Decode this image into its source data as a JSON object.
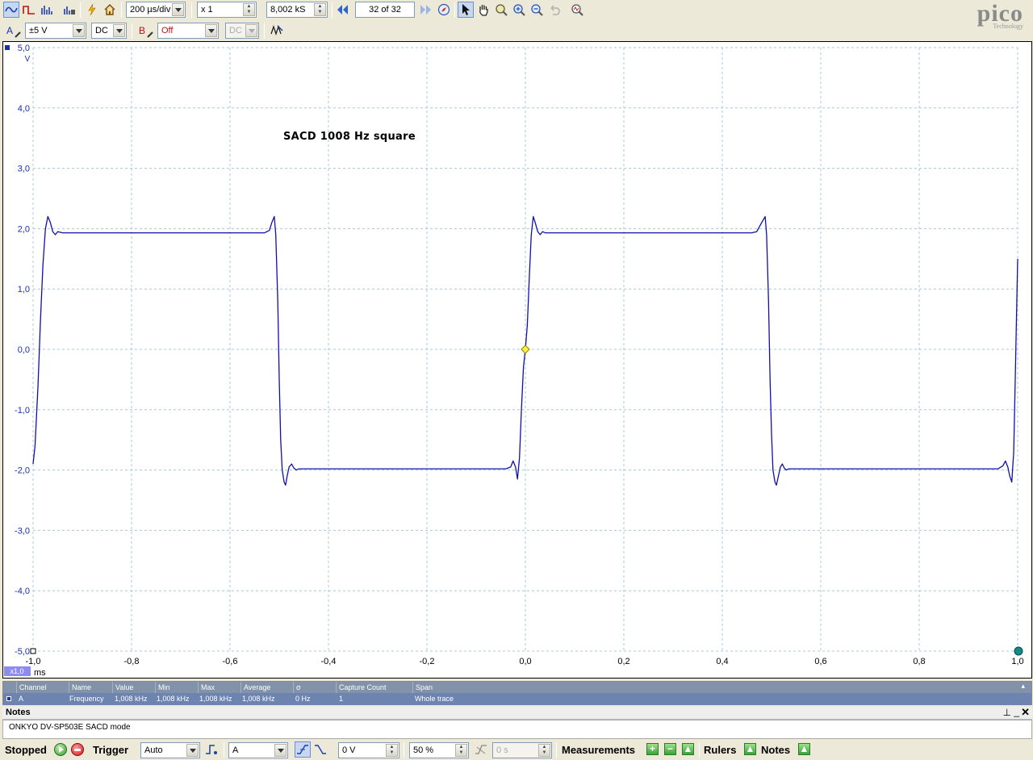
{
  "toolbar": {
    "timebase": "200 µs/div",
    "zoom": "x 1",
    "samples": "8,002 kS",
    "capture_index": "32 of 32"
  },
  "channel_a": {
    "label": "A",
    "range": "±5 V",
    "coupling": "DC"
  },
  "channel_b": {
    "label": "B",
    "range": "Off",
    "coupling": "DC"
  },
  "logo": {
    "main": "pico",
    "sub": "Technology"
  },
  "scope": {
    "title": "SACD 1008 Hz square",
    "y_unit": "V",
    "x_unit": "ms",
    "zoom_badge": "x1,0",
    "trace_color": "#1010a8",
    "grid_color": "#a8c8d8"
  },
  "chart_data": {
    "type": "line",
    "title": "SACD 1008 Hz square",
    "xlabel": "ms",
    "ylabel": "V",
    "xlim": [
      -1.0,
      1.0
    ],
    "ylim": [
      -5.0,
      5.0
    ],
    "grid": true,
    "x_ticks": [
      "-1,0",
      "-0,8",
      "-0,6",
      "-0,4",
      "-0,2",
      "0,0",
      "0,2",
      "0,4",
      "0,6",
      "0,8",
      "1,0"
    ],
    "y_ticks": [
      "5,0",
      "4,0",
      "3,0",
      "2,0",
      "1,0",
      "0,0",
      "-1,0",
      "-2,0",
      "-3,0",
      "-4,0",
      "-5,0"
    ],
    "series": [
      {
        "x": [
          -1.0,
          -0.996,
          -0.99,
          -0.985,
          -0.98,
          -0.975,
          -0.97,
          -0.965,
          -0.96,
          -0.955,
          -0.95,
          -0.94,
          -0.93,
          -0.9,
          -0.7,
          -0.53,
          -0.52,
          -0.515,
          -0.51,
          -0.507,
          -0.503,
          -0.5,
          -0.497,
          -0.494,
          -0.49,
          -0.487,
          -0.484,
          -0.48,
          -0.475,
          -0.47,
          -0.465,
          -0.46,
          -0.45,
          -0.4,
          -0.1,
          -0.04,
          -0.03,
          -0.025,
          -0.02,
          -0.016,
          -0.012,
          -0.008,
          -0.004,
          0.0,
          0.004,
          0.008,
          0.012,
          0.016,
          0.02,
          0.025,
          0.03,
          0.035,
          0.04,
          0.05,
          0.1,
          0.45,
          0.46,
          0.47,
          0.48,
          0.487,
          0.49,
          0.494,
          0.497,
          0.5,
          0.503,
          0.507,
          0.51,
          0.514,
          0.518,
          0.522,
          0.526,
          0.53,
          0.535,
          0.54,
          0.55,
          0.6,
          0.9,
          0.96,
          0.97,
          0.975,
          0.98,
          0.984,
          0.988,
          0.992,
          0.995,
          0.998,
          1.0
        ],
        "y": [
          -1.9,
          -1.6,
          -0.6,
          0.5,
          1.4,
          2.0,
          2.2,
          2.1,
          1.95,
          1.9,
          1.95,
          1.93,
          1.93,
          1.93,
          1.93,
          1.93,
          1.97,
          2.1,
          2.2,
          1.9,
          0.8,
          -0.5,
          -1.5,
          -2.0,
          -2.2,
          -2.25,
          -2.1,
          -1.95,
          -1.9,
          -1.97,
          -2.0,
          -1.98,
          -1.98,
          -1.98,
          -1.98,
          -1.98,
          -1.95,
          -1.85,
          -1.95,
          -2.15,
          -1.8,
          -1.0,
          -0.3,
          0.0,
          0.4,
          1.2,
          1.9,
          2.2,
          2.1,
          1.95,
          1.9,
          1.95,
          1.93,
          1.93,
          1.93,
          1.93,
          1.93,
          1.95,
          2.1,
          2.2,
          1.9,
          0.8,
          -0.5,
          -1.4,
          -2.0,
          -2.2,
          -2.25,
          -2.1,
          -1.95,
          -1.9,
          -1.97,
          -2.0,
          -1.98,
          -1.98,
          -1.98,
          -1.98,
          -1.98,
          -1.98,
          -1.93,
          -1.85,
          -1.95,
          -2.1,
          -2.2,
          -1.7,
          -0.5,
          0.7,
          1.5
        ]
      }
    ]
  },
  "measurements": {
    "headers": [
      "Channel",
      "Name",
      "Value",
      "Min",
      "Max",
      "Average",
      "σ",
      "Capture Count",
      "Span"
    ],
    "row": [
      "A",
      "Frequency",
      "1,008 kHz",
      "1,008 kHz",
      "1,008 kHz",
      "1,008 kHz",
      "0 Hz",
      "1",
      "Whole trace"
    ]
  },
  "notes": {
    "title": "Notes",
    "text": "ONKYO DV-SP503E SACD mode"
  },
  "statusbar": {
    "state": "Stopped",
    "trigger_label": "Trigger",
    "trigger_mode": "Auto",
    "trigger_source": "A",
    "trigger_level": "0 V",
    "pre_trigger": "50 %",
    "delay": "0 s",
    "measurements_label": "Measurements",
    "rulers_label": "Rulers",
    "notes_label": "Notes"
  }
}
